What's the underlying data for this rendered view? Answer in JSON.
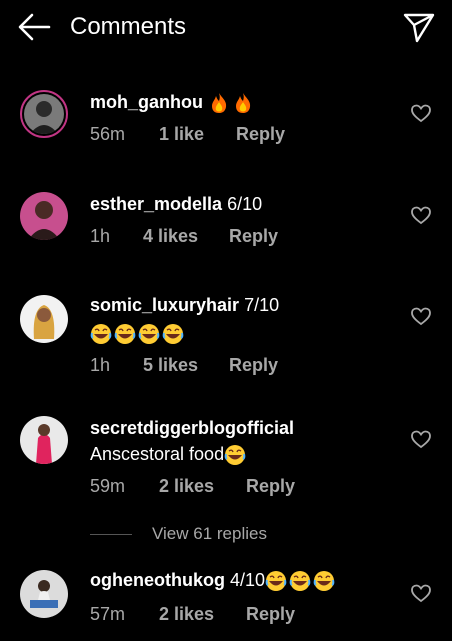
{
  "header": {
    "title": "Comments",
    "back_icon": "arrow-left-icon",
    "send_icon": "paper-plane-icon"
  },
  "comments": [
    {
      "username": "moh_ganhou",
      "text": "",
      "emojis": [
        "🔥",
        "🔥"
      ],
      "second_line": "",
      "second_emojis": [],
      "time": "56m",
      "likes": "1 like",
      "reply": "Reply"
    },
    {
      "username": "esther_modella",
      "text": "6/10",
      "emojis": [],
      "second_line": "",
      "second_emojis": [],
      "time": "1h",
      "likes": "4 likes",
      "reply": "Reply"
    },
    {
      "username": "somic_luxuryhair",
      "text": "7/10",
      "emojis": [],
      "second_line": "",
      "second_emojis": [
        "😂",
        "😂",
        "😂",
        "😂"
      ],
      "time": "1h",
      "likes": "5 likes",
      "reply": "Reply"
    },
    {
      "username": "secretdiggerblogofficial",
      "text": "",
      "emojis": [],
      "second_line": "Anscestoral food",
      "second_emojis": [
        "😂"
      ],
      "time": "59m",
      "likes": "2 likes",
      "reply": "Reply"
    },
    {
      "username": "ogheneothukog",
      "text": "4/10",
      "emojis": [
        "😂",
        "😂",
        "😂"
      ],
      "second_line": "",
      "second_emojis": [],
      "time": "57m",
      "likes": "2 likes",
      "reply": "Reply"
    }
  ],
  "view_replies": "View 61 replies",
  "colors": {
    "background": "#000000",
    "muted_text": "#a8a8a8",
    "story_ring": "#c13584"
  }
}
